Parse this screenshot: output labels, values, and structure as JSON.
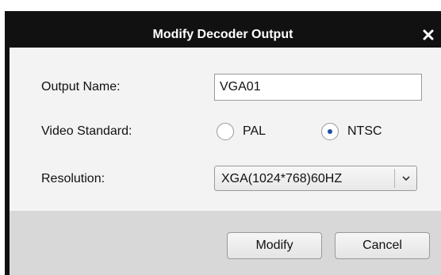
{
  "dialog": {
    "title": "Modify Decoder Output",
    "close_symbol": "✕"
  },
  "form": {
    "output_name": {
      "label": "Output Name:",
      "value": "VGA01"
    },
    "video_standard": {
      "label": "Video Standard:",
      "options": [
        {
          "label": "PAL",
          "selected": false
        },
        {
          "label": "NTSC",
          "selected": true
        }
      ]
    },
    "resolution": {
      "label": "Resolution:",
      "selected": "XGA(1024*768)60HZ"
    }
  },
  "buttons": {
    "modify_label": "Modify",
    "cancel_label": "Cancel"
  },
  "colors": {
    "title_bar": "#111111",
    "panel": "#f3f3f3",
    "footer": "#d8d8d8",
    "radio_selected": "#1f4fa6"
  }
}
